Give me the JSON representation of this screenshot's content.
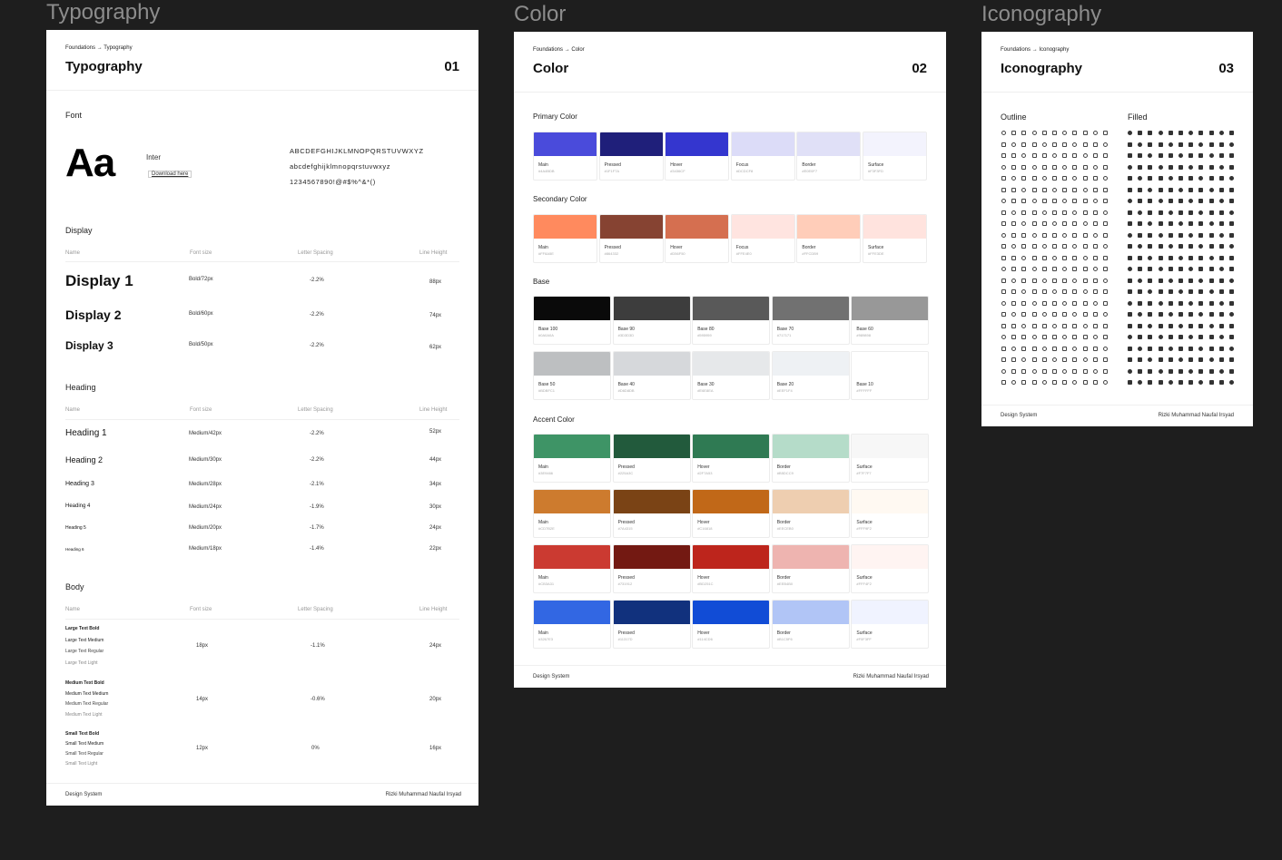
{
  "frames": [
    {
      "label": "Typography"
    },
    {
      "label": "Color"
    },
    {
      "label": "Iconography"
    }
  ],
  "typography": {
    "crumb": "Foundations → Typography",
    "title": "Typography",
    "number": "01",
    "font_section": "Font",
    "sample": "Aa",
    "font_name": "Inter",
    "download": "Download here",
    "upper": "ABCDEFGHIJKLMNOPQRSTUVWXYZ",
    "lower": "abcdefghijklmnopqrstuvwxyz",
    "digits": "1234567890!@#$%^&*()",
    "columns": [
      "Name",
      "Font size",
      "Letter Spacing",
      "Line Height"
    ],
    "display_section": "Display",
    "display_rows": [
      {
        "name": "Display 1",
        "size": "Bold/72px",
        "spacing": "-2.2%",
        "line": "88px"
      },
      {
        "name": "Display 2",
        "size": "Bold/60px",
        "spacing": "-2.2%",
        "line": "74px"
      },
      {
        "name": "Display 3",
        "size": "Bold/50px",
        "spacing": "-2.2%",
        "line": "62px"
      }
    ],
    "heading_section": "Heading",
    "heading_rows": [
      {
        "name": "Heading 1",
        "size": "Medium/42px",
        "spacing": "-2.2%",
        "line": "52px"
      },
      {
        "name": "Heading 2",
        "size": "Medium/30px",
        "spacing": "-2.2%",
        "line": "44px"
      },
      {
        "name": "Heading 3",
        "size": "Medium/28px",
        "spacing": "-2.1%",
        "line": "34px"
      },
      {
        "name": "Heading 4",
        "size": "Medium/24px",
        "spacing": "-1.9%",
        "line": "30px"
      },
      {
        "name": "Heading 5",
        "size": "Medium/20px",
        "spacing": "-1.7%",
        "line": "24px"
      },
      {
        "name": "Heading 6",
        "size": "Medium/18px",
        "spacing": "-1.4%",
        "line": "22px"
      }
    ],
    "body_section": "Body",
    "body_rows": [
      {
        "names": [
          "Large Text Bold",
          "Large Text Medium",
          "Large Text Regular",
          "Large Text Light"
        ],
        "size": "18px",
        "spacing": "-1.1%",
        "line": "24px"
      },
      {
        "names": [
          "Medium Text Bold",
          "Medium Text Medium",
          "Medium Text Regular",
          "Medium Text Light"
        ],
        "size": "14px",
        "spacing": "-0.6%",
        "line": "20px"
      },
      {
        "names": [
          "Small Text Bold",
          "Small Text Medium",
          "Small Text Regular",
          "Small Text Light"
        ],
        "size": "12px",
        "spacing": "0%",
        "line": "16px"
      }
    ],
    "footer_left": "Design System",
    "footer_right": "Rizki Muhammad Naufal Irsyad"
  },
  "color": {
    "crumb": "Foundations → Color",
    "title": "Color",
    "number": "02",
    "primary_section": "Primary Color",
    "primary": [
      {
        "name": "Main",
        "hex": "#4A4BDB",
        "color": "#4a4bdb"
      },
      {
        "name": "Pressed",
        "hex": "#1F1F7A",
        "color": "#1f1f7a"
      },
      {
        "name": "Hover",
        "hex": "#3436CF",
        "color": "#3436cf"
      },
      {
        "name": "Focus",
        "hex": "#DCDCF8",
        "color": "#dcdcf8"
      },
      {
        "name": "Border",
        "hex": "#E0E0F7",
        "color": "#e0e0f7"
      },
      {
        "name": "Surface",
        "hex": "#F3F3FD",
        "color": "#f3f3fd"
      }
    ],
    "secondary_section": "Secondary Color",
    "secondary": [
      {
        "name": "Main",
        "hex": "#FF8A5E",
        "color": "#ff8a5e"
      },
      {
        "name": "Pressed",
        "hex": "#864332",
        "color": "#864332"
      },
      {
        "name": "Hover",
        "hex": "#D56F50",
        "color": "#d56f50"
      },
      {
        "name": "Focus",
        "hex": "#FFE4E0",
        "color": "#ffe4e0"
      },
      {
        "name": "Border",
        "hex": "#FFCDB9",
        "color": "#ffcdb9"
      },
      {
        "name": "Surface",
        "hex": "#FFE3DE",
        "color": "#ffe3de"
      }
    ],
    "base_section": "Base",
    "base_row1": [
      {
        "name": "Base 100",
        "hex": "#0A0A0A",
        "color": "#0a0a0a"
      },
      {
        "name": "Base 90",
        "hex": "#3D3D3D",
        "color": "#3d3d3d"
      },
      {
        "name": "Base 80",
        "hex": "#595959",
        "color": "#595959"
      },
      {
        "name": "Base 70",
        "hex": "#717171",
        "color": "#717171"
      },
      {
        "name": "Base 60",
        "hex": "#989898",
        "color": "#989898"
      }
    ],
    "base_row2": [
      {
        "name": "Base 50",
        "hex": "#BDBFC1",
        "color": "#bdbfc1"
      },
      {
        "name": "Base 40",
        "hex": "#D6D8DB",
        "color": "#d6d8db"
      },
      {
        "name": "Base 30",
        "hex": "#E6E8EA",
        "color": "#e6e8ea"
      },
      {
        "name": "Base 20",
        "hex": "#EEF1F4",
        "color": "#eef1f4"
      },
      {
        "name": "Base 10",
        "hex": "#FFFFFF",
        "color": "#ffffff"
      }
    ],
    "accent_section": "Accent Color",
    "accent_rows": [
      [
        {
          "name": "Main",
          "hex": "#3E9466",
          "color": "#3e9466"
        },
        {
          "name": "Pressed",
          "hex": "#225A3C",
          "color": "#225a3c"
        },
        {
          "name": "Hover",
          "hex": "#2F7A53",
          "color": "#2f7a53"
        },
        {
          "name": "Border",
          "hex": "#B5DCC9",
          "color": "#b5dcc9"
        },
        {
          "name": "Surface",
          "hex": "#F7F7F7",
          "color": "#f7f7f7"
        }
      ],
      [
        {
          "name": "Main",
          "hex": "#CD7B2E",
          "color": "#cd7b2e"
        },
        {
          "name": "Pressed",
          "hex": "#7A4315",
          "color": "#7a4315"
        },
        {
          "name": "Hover",
          "hex": "#C16818",
          "color": "#c16818"
        },
        {
          "name": "Border",
          "hex": "#EECEB0",
          "color": "#eeceb0"
        },
        {
          "name": "Surface",
          "hex": "#FFF9F2",
          "color": "#fff9f2"
        }
      ],
      [
        {
          "name": "Main",
          "hex": "#CB3A31",
          "color": "#cb3a31"
        },
        {
          "name": "Pressed",
          "hex": "#731912",
          "color": "#731912"
        },
        {
          "name": "Hover",
          "hex": "#BD251C",
          "color": "#bd251c"
        },
        {
          "name": "Border",
          "hex": "#EEB4B0",
          "color": "#eeb4b0"
        },
        {
          "name": "Surface",
          "hex": "#FFF4F2",
          "color": "#fff4f2"
        }
      ],
      [
        {
          "name": "Main",
          "hex": "#3267E3",
          "color": "#3267e3"
        },
        {
          "name": "Pressed",
          "hex": "#11317D",
          "color": "#11317d"
        },
        {
          "name": "Hover",
          "hex": "#114CD6",
          "color": "#114cd6"
        },
        {
          "name": "Border",
          "hex": "#B1C5F6",
          "color": "#b1c5f6"
        },
        {
          "name": "Surface",
          "hex": "#F0F3FF",
          "color": "#f0f3ff"
        }
      ]
    ],
    "footer_left": "Design System",
    "footer_right": "Rizki Muhammad Naufal Irsyad"
  },
  "iconography": {
    "crumb": "Foundations → Iconography",
    "title": "Iconography",
    "number": "03",
    "outline_label": "Outline",
    "filled_label": "Filled",
    "footer_left": "Design System",
    "footer_right": "Rizki Muhammad Naufal Irsyad"
  }
}
